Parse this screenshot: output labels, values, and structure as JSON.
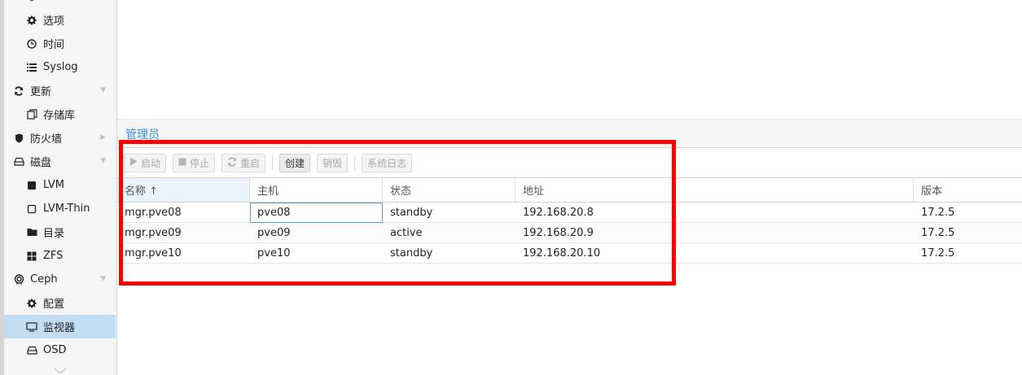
{
  "sidebar": {
    "items": [
      {
        "label": "选项",
        "icon": "gear-icon",
        "level": "sub",
        "selected": false
      },
      {
        "label": "时间",
        "icon": "clock-icon",
        "level": "sub",
        "selected": false
      },
      {
        "label": "Syslog",
        "icon": "list-icon",
        "level": "sub",
        "selected": false
      },
      {
        "label": "更新",
        "icon": "refresh-icon",
        "level": "top",
        "selected": false,
        "expanded": true
      },
      {
        "label": "存储库",
        "icon": "repository-icon",
        "level": "sub",
        "selected": false
      },
      {
        "label": "防火墙",
        "icon": "shield-icon",
        "level": "top",
        "selected": false,
        "expanded": false
      },
      {
        "label": "磁盘",
        "icon": "disk-icon",
        "level": "top",
        "selected": false,
        "expanded": true
      },
      {
        "label": "LVM",
        "icon": "square-filled-icon",
        "level": "sub",
        "selected": false
      },
      {
        "label": "LVM-Thin",
        "icon": "square-outline-icon",
        "level": "sub",
        "selected": false
      },
      {
        "label": "目录",
        "icon": "folder-icon",
        "level": "sub",
        "selected": false
      },
      {
        "label": "ZFS",
        "icon": "grid-icon",
        "level": "sub",
        "selected": false
      },
      {
        "label": "Ceph",
        "icon": "ceph-icon",
        "level": "top",
        "selected": false,
        "expanded": true
      },
      {
        "label": "配置",
        "icon": "gear-icon",
        "level": "sub",
        "selected": false
      },
      {
        "label": "监视器",
        "icon": "monitor-icon",
        "level": "sub",
        "selected": true
      },
      {
        "label": "OSD",
        "icon": "disk-icon",
        "level": "sub",
        "selected": false
      }
    ]
  },
  "panel": {
    "title": "管理员"
  },
  "toolbar": {
    "start_label": "启动",
    "stop_label": "停止",
    "restart_label": "重启",
    "create_label": "创建",
    "destroy_label": "销毁",
    "syslog_label": "系统日志"
  },
  "table": {
    "columns": [
      "名称 ↑",
      "主机",
      "状态",
      "地址",
      "版本"
    ],
    "rows": [
      {
        "name": "mgr.pve08",
        "host": "pve08",
        "status": "standby",
        "address": "192.168.20.8",
        "version": "17.2.5"
      },
      {
        "name": "mgr.pve09",
        "host": "pve09",
        "status": "active",
        "address": "192.168.20.9",
        "version": "17.2.5"
      },
      {
        "name": "mgr.pve10",
        "host": "pve10",
        "status": "standby",
        "address": "192.168.20.10",
        "version": "17.2.5"
      }
    ]
  },
  "colors": {
    "accent": "#3892d4",
    "selected_bg": "#c2ddf2",
    "highlight": "#ff0000"
  }
}
